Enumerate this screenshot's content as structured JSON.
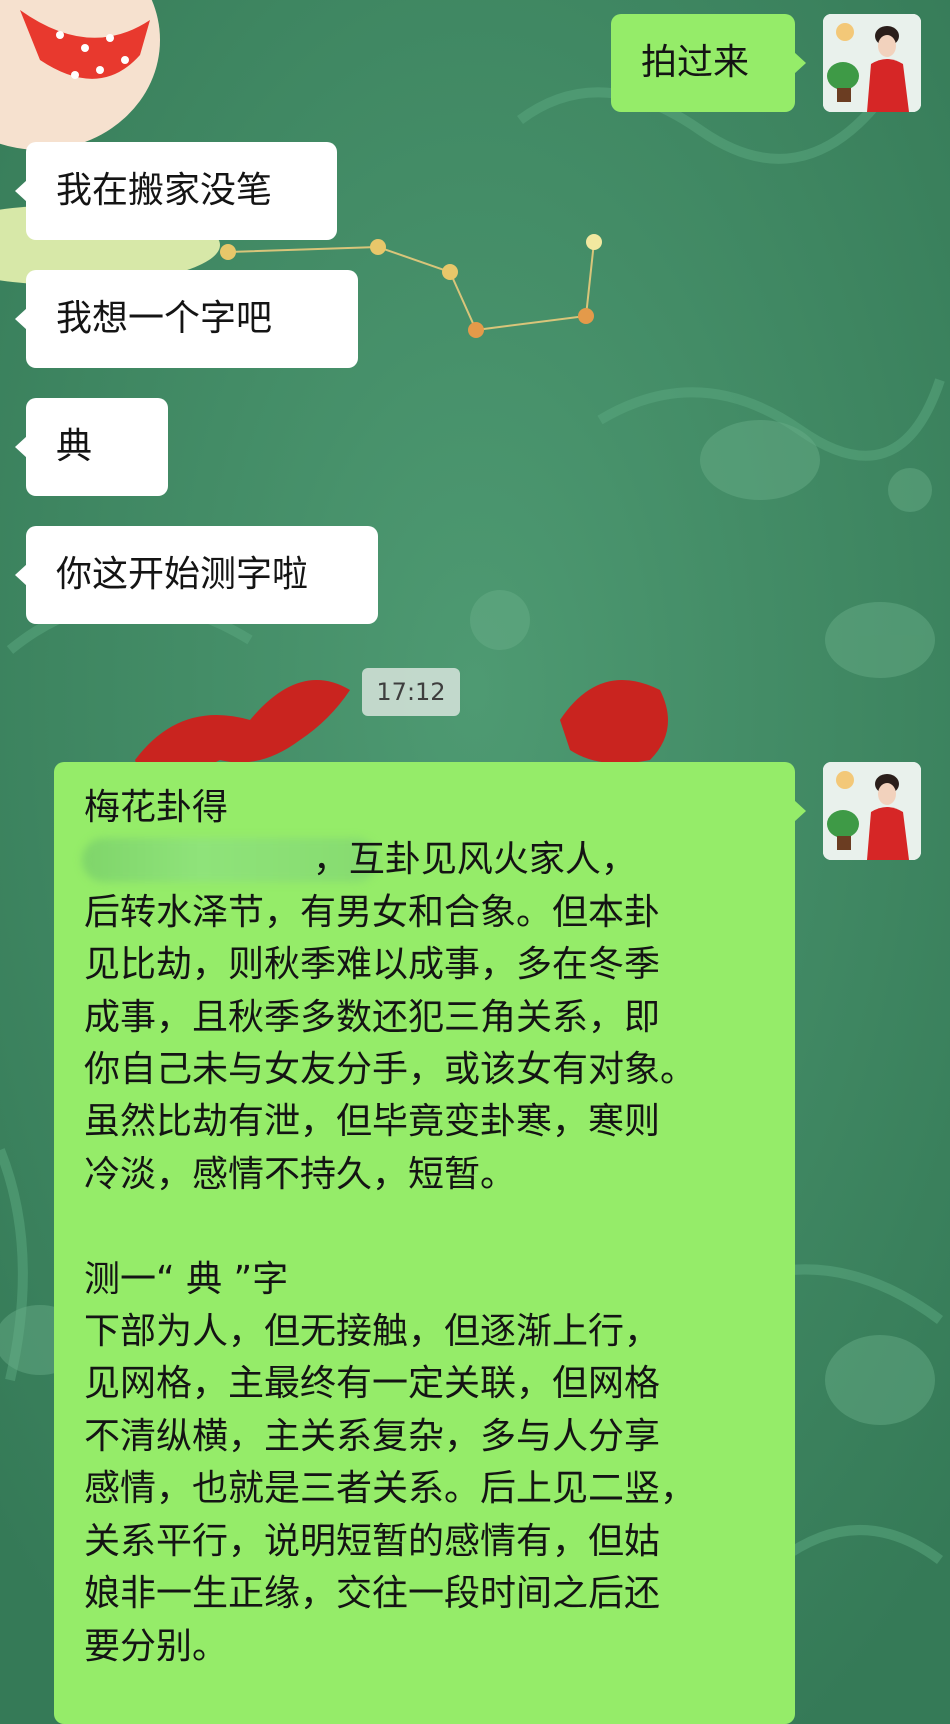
{
  "chat": {
    "messages": [
      {
        "text": "拍过来",
        "sender": "self"
      },
      {
        "text": "我在搬家没笔",
        "sender": "other"
      },
      {
        "text": "我想一个字吧",
        "sender": "other"
      },
      {
        "text": "典",
        "sender": "other"
      },
      {
        "text": "你这开始测字啦",
        "sender": "other"
      }
    ],
    "timestamp": "17:12",
    "long_message": {
      "sender": "self",
      "text": "梅花卦得\n                    ，互卦见风火家人，\n后转水泽节，有男女和合象。但本卦\n见比劫，则秋季难以成事，多在冬季\n成事，且秋季多数还犯三角关系，即\n你自己未与女友分手，或该女有对象。\n虽然比劫有泄，但毕竟变卦寒，寒则\n冷淡，感情不持久，短暂。\n\n测一“ 典 ”字\n下部为人，但无接触，但逐渐上行，\n见网格，主最终有一定关联，但网格\n不清纵横，主关系复杂，多与人分享\n感情，也就是三者关系。后上见二竖，\n关系平行，说明短暂的感情有，但姑\n娘非一生正缘，交往一段时间之后还\n要分别。"
    }
  },
  "colors": {
    "background": "#3f8a63",
    "incoming_bubble": "#ffffff",
    "outgoing_bubble": "#95ec69",
    "text": "#141414"
  }
}
